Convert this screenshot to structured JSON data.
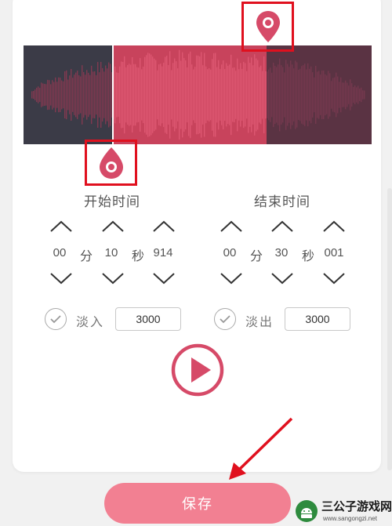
{
  "start_section": {
    "title": "开始时间",
    "minutes": "00",
    "minutes_unit": "分",
    "seconds": "10",
    "seconds_unit": "秒",
    "milliseconds": "914",
    "fade_label": "淡入",
    "fade_value": "3000"
  },
  "end_section": {
    "title": "结束时间",
    "minutes": "00",
    "minutes_unit": "分",
    "seconds": "30",
    "seconds_unit": "秒",
    "milliseconds": "001",
    "fade_label": "淡出",
    "fade_value": "3000"
  },
  "save_label": "保存",
  "watermark": {
    "title": "三公子游戏网",
    "url": "www.sangongzi.net"
  },
  "colors": {
    "accent": "#d64a68",
    "waveform_bg": "#3b3b47",
    "save_button": "#f28092",
    "highlight_box": "#e0101e"
  },
  "icons": {
    "marker": "map-pin-icon",
    "play": "play-icon",
    "check": "check-icon",
    "up": "chevron-up-icon",
    "down": "chevron-down-icon"
  }
}
